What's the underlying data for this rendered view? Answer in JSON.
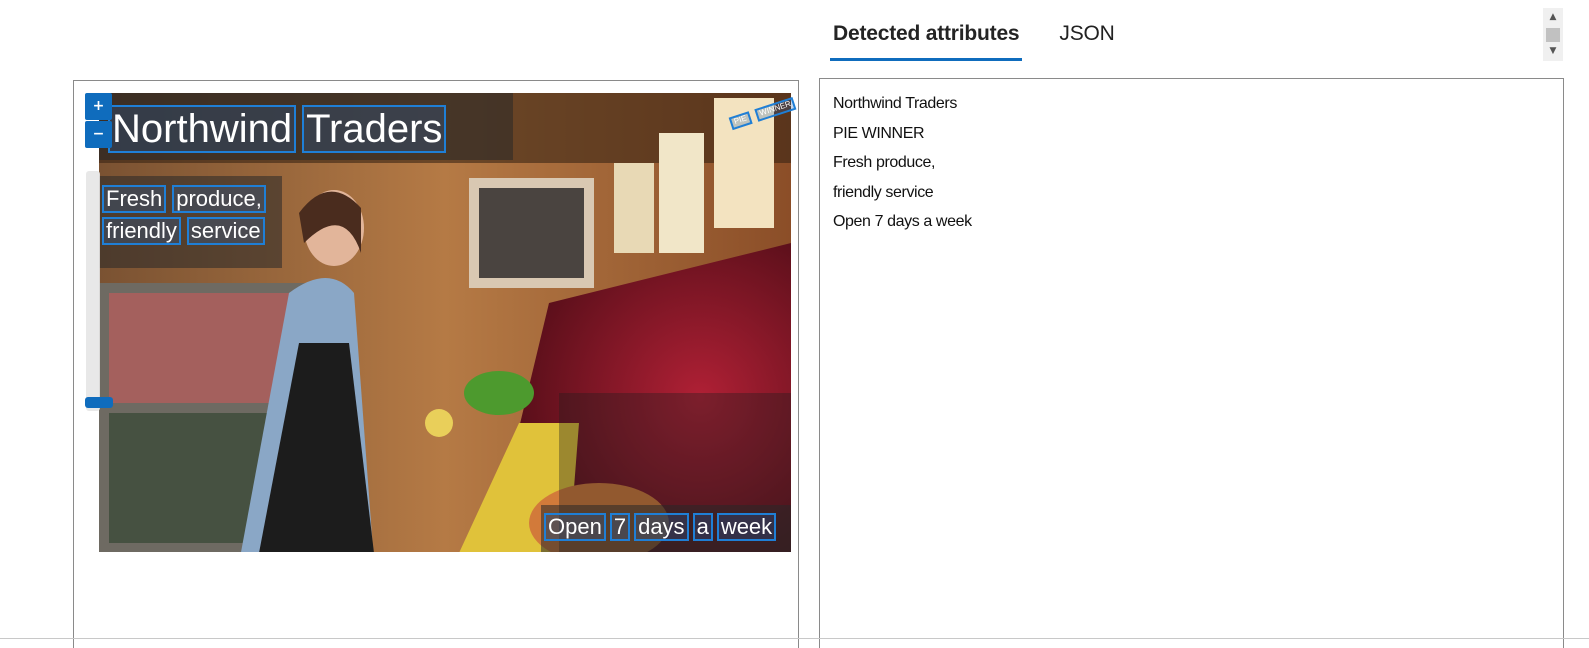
{
  "tabs": [
    {
      "label": "Detected attributes",
      "active": true
    },
    {
      "label": "JSON",
      "active": false
    }
  ],
  "viewer": {
    "zoom_in_label": "+",
    "zoom_out_label": "−",
    "zoom_level": 0.08,
    "overlay": {
      "title_words": [
        "Northwind",
        "Traders"
      ],
      "subtitle_line1_words": [
        "Fresh",
        "produce,"
      ],
      "subtitle_line2_words": [
        "friendly",
        "service"
      ],
      "footer_words": [
        "Open",
        "7",
        "days",
        "a",
        "week"
      ],
      "sign_words": [
        "PIE",
        "WINNER"
      ]
    }
  },
  "results": {
    "lines": [
      "Northwind Traders",
      "PIE WINNER",
      "Fresh produce,",
      "friendly service",
      "Open 7 days a week"
    ]
  },
  "colors": {
    "accent": "#0f6cbd",
    "ocr_box": "#1f7fd6"
  },
  "icons": {
    "scroll_up": "triangle-up-icon",
    "scroll_down": "triangle-down-icon"
  }
}
